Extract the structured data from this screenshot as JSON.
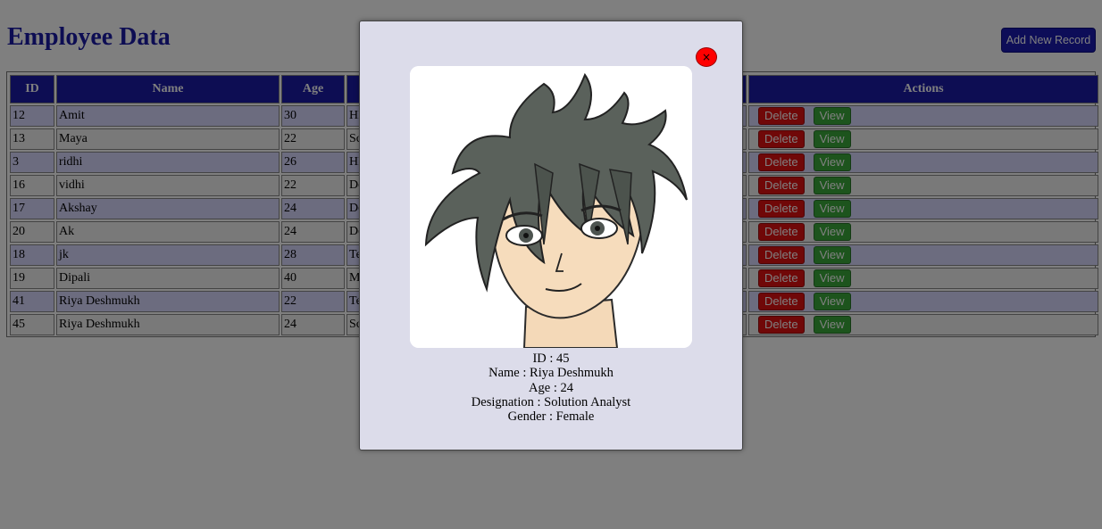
{
  "page": {
    "title": "Employee Data",
    "add_button": "Add New Record"
  },
  "table": {
    "headers": [
      "ID",
      "Name",
      "Age",
      "Actions"
    ],
    "rows": [
      {
        "id": "12",
        "name": "Amit",
        "age": "30",
        "designation": "HR"
      },
      {
        "id": "13",
        "name": "Maya",
        "age": "22",
        "designation": "Sc"
      },
      {
        "id": "3",
        "name": "ridhi",
        "age": "26",
        "designation": "HR"
      },
      {
        "id": "16",
        "name": "vidhi",
        "age": "22",
        "designation": "De"
      },
      {
        "id": "17",
        "name": "Akshay",
        "age": "24",
        "designation": "De"
      },
      {
        "id": "20",
        "name": "Ak",
        "age": "24",
        "designation": "De"
      },
      {
        "id": "18",
        "name": "jk",
        "age": "28",
        "designation": "Te"
      },
      {
        "id": "19",
        "name": "Dipali",
        "age": "40",
        "designation": "M"
      },
      {
        "id": "41",
        "name": "Riya Deshmukh",
        "age": "22",
        "designation": "Te"
      },
      {
        "id": "45",
        "name": "Riya Deshmukh",
        "age": "24",
        "designation": "Sc"
      }
    ],
    "delete_label": "Delete",
    "view_label": "View"
  },
  "modal": {
    "close_label": "×",
    "avatar_icon": "anime-character-portrait",
    "details": [
      "ID : 45",
      "Name : Riya Deshmukh",
      "Age : 24",
      "Designation : Solution Analyst",
      "Gender : Female"
    ]
  },
  "colors": {
    "title": "#1a1aa6",
    "header_bg": "#1a1aa6",
    "row_alt": "#d8d8ff",
    "delete": "#e01010",
    "view": "#3aa83a",
    "close": "#ff0000",
    "modal_bg": "#dcdcea"
  }
}
